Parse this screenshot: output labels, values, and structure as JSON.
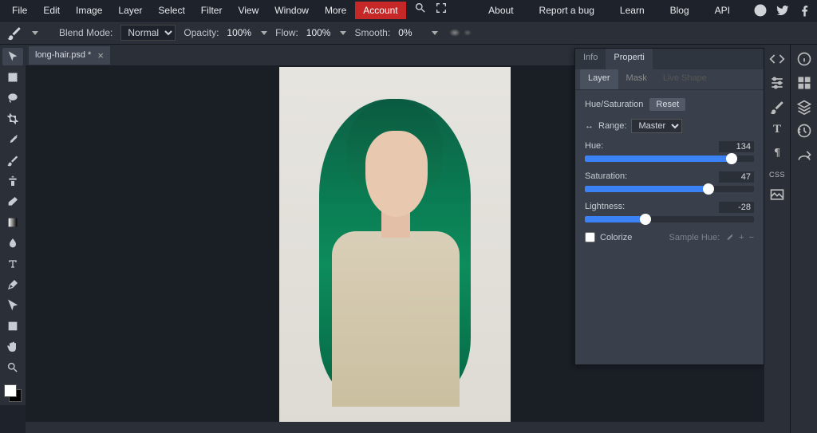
{
  "menu": {
    "items": [
      "File",
      "Edit",
      "Image",
      "Layer",
      "Select",
      "Filter",
      "View",
      "Window",
      "More"
    ],
    "account": "Account",
    "right": [
      "About",
      "Report a bug",
      "Learn",
      "Blog",
      "API"
    ]
  },
  "optbar": {
    "blend_label": "Blend Mode:",
    "blend_value": "Normal",
    "opacity_label": "Opacity:",
    "opacity_value": "100%",
    "flow_label": "Flow:",
    "flow_value": "100%",
    "smooth_label": "Smooth:",
    "smooth_value": "0%"
  },
  "doc": {
    "tab_title": "long-hair.psd *"
  },
  "panel": {
    "tabs": [
      "Info",
      "Properti"
    ],
    "subtabs": {
      "layer": "Layer",
      "mask": "Mask",
      "live": "Live Shape"
    },
    "adj_name": "Hue/Saturation",
    "reset": "Reset",
    "range_label": "Range:",
    "range_value": "Master",
    "hue_label": "Hue:",
    "hue_value": "134",
    "sat_label": "Saturation:",
    "sat_value": "47",
    "lig_label": "Lightness:",
    "lig_value": "-28",
    "colorize": "Colorize",
    "sample": "Sample Hue:"
  },
  "rsb": {
    "css": "CSS"
  },
  "sliders": {
    "hue_pct": 87,
    "sat_pct": 73,
    "lig_pct": 36
  }
}
